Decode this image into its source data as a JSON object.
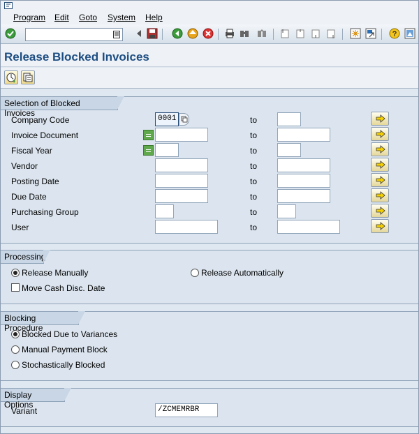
{
  "menu": [
    {
      "label": "Program"
    },
    {
      "label": "Edit"
    },
    {
      "label": "Goto"
    },
    {
      "label": "System"
    },
    {
      "label": "Help"
    }
  ],
  "toolbar": {
    "command_field_value": "",
    "icons": [
      "enter-icon",
      "save-icon",
      "back-icon",
      "exit-icon",
      "cancel-icon",
      "print-icon",
      "find-icon",
      "find-next-icon",
      "first-page-icon",
      "previous-page-icon",
      "next-page-icon",
      "last-page-icon",
      "create-session-icon",
      "shortcut-icon",
      "help-icon",
      "customize-layout-icon"
    ]
  },
  "title": "Release Blocked Invoices",
  "app_toolbar": {
    "buttons": [
      "execute-icon",
      "get-variant-icon"
    ]
  },
  "selection": {
    "title": "Selection of Blocked Invoices",
    "to_label": "to",
    "rows": [
      {
        "label": "Company Code",
        "from": "0001",
        "to": ""
      },
      {
        "label": "Invoice Document",
        "from": "",
        "to": ""
      },
      {
        "label": "Fiscal Year",
        "from": "",
        "to": ""
      },
      {
        "label": "Vendor",
        "from": "",
        "to": ""
      },
      {
        "label": "Posting Date",
        "from": "",
        "to": ""
      },
      {
        "label": "Due Date",
        "from": "",
        "to": ""
      },
      {
        "label": "Purchasing Group",
        "from": "",
        "to": ""
      },
      {
        "label": "User",
        "from": "",
        "to": ""
      }
    ]
  },
  "processing": {
    "title": "Processing",
    "release_manually": "Release Manually",
    "release_automatically": "Release Automatically",
    "move_cash_disc": "Move Cash Disc. Date",
    "selected": "release_manually",
    "move_cash_disc_checked": false
  },
  "blocking": {
    "title": "Blocking Procedure",
    "options": [
      {
        "label": "Blocked Due to Variances",
        "selected": true
      },
      {
        "label": "Manual Payment Block",
        "selected": false
      },
      {
        "label": "Stochastically Blocked",
        "selected": false
      }
    ]
  },
  "display": {
    "title": "Display Options",
    "variant_label": "Variant",
    "variant_value": "/ZCMEMRBR"
  },
  "colors": {
    "title": "#1e4e82",
    "background": "#dfe7f0"
  }
}
